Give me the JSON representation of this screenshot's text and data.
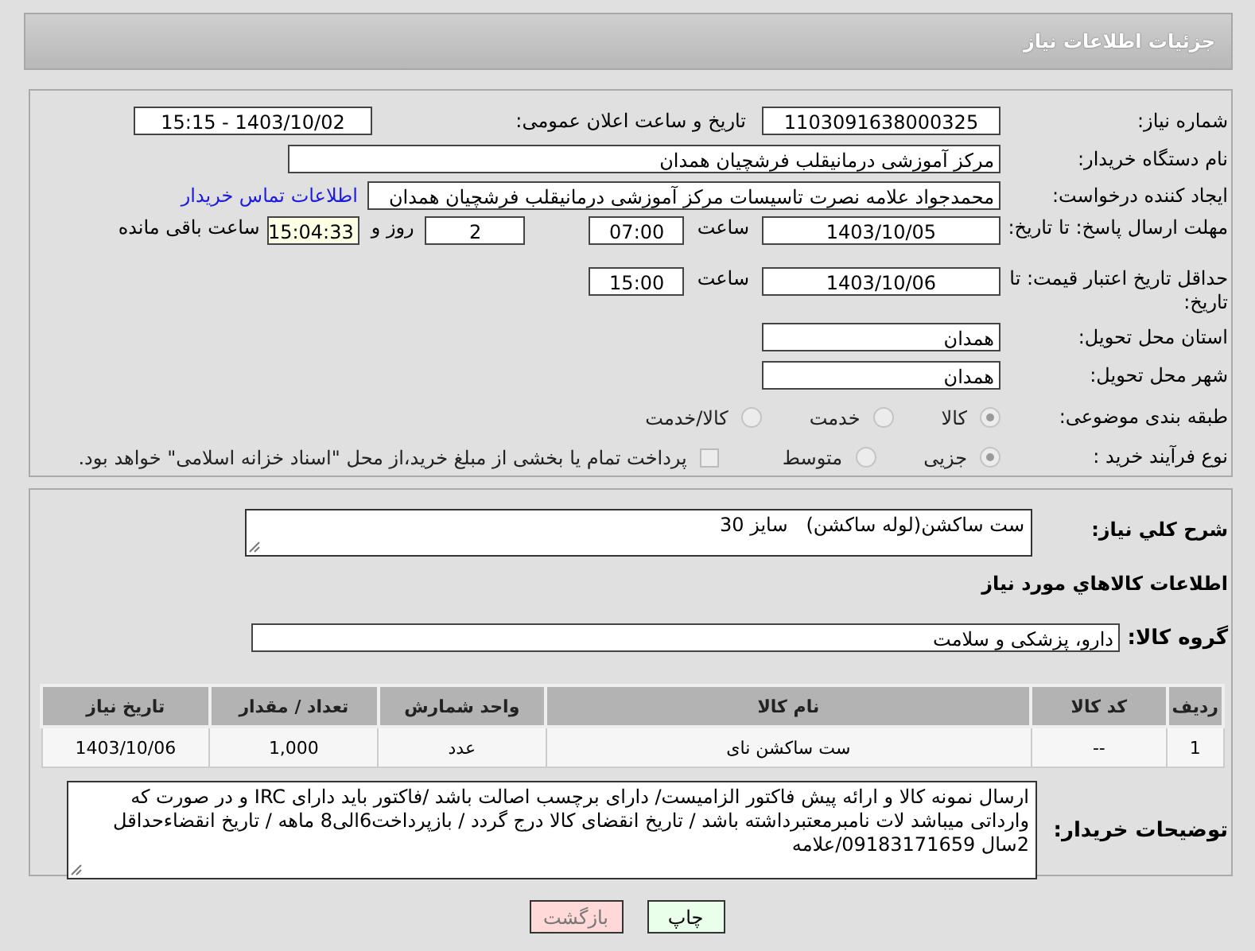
{
  "header": {
    "title": "جزئیات اطلاعات نیاز"
  },
  "need_number": {
    "label": "شماره نیاز:",
    "value": "1103091638000325"
  },
  "announce": {
    "label": "تاریخ و ساعت اعلان عمومی:",
    "value": "1403/10/02 - 15:15"
  },
  "buyer": {
    "label": "نام دستگاه خریدار:",
    "value": "مرکز آموزشی درمانیقلب فرشچیان همدان"
  },
  "creator": {
    "label": "ایجاد کننده درخواست:",
    "value": "محمدجواد علامه نصرت تاسیسات مرکز آموزشی درمانیقلب فرشچیان همدان",
    "link": "اطلاعات تماس خریدار"
  },
  "reply_deadline": {
    "label": "مهلت ارسال پاسخ: تا تاریخ:",
    "date": "1403/10/05",
    "time_label": "ساعت",
    "time": "07:00",
    "days": "2",
    "days_label": "روز و",
    "remaining": "15:04:33",
    "remaining_label": "ساعت باقی مانده"
  },
  "price_validity": {
    "label": "حداقل تاریخ اعتبار قیمت: تا تاریخ:",
    "date": "1403/10/06",
    "time_label": "ساعت",
    "time": "15:00"
  },
  "province": {
    "label": "استان محل تحویل:",
    "value": "همدان"
  },
  "city": {
    "label": "شهر محل تحویل:",
    "value": "همدان"
  },
  "category": {
    "label": "طبقه بندی موضوعی:",
    "options": [
      {
        "label": "کالا",
        "selected": true
      },
      {
        "label": "خدمت",
        "selected": false
      },
      {
        "label": "کالا/خدمت",
        "selected": false
      }
    ]
  },
  "process": {
    "label": "نوع فرآیند خرید :",
    "options": [
      {
        "label": "جزیی",
        "selected": true
      },
      {
        "label": "متوسط",
        "selected": false
      }
    ],
    "payment": {
      "label": "پرداخت تمام یا بخشی از مبلغ خرید،از محل \"اسناد خزانه اسلامی\" خواهد بود.",
      "checked": false
    }
  },
  "description": {
    "label": "شرح کلي نياز:",
    "value": "ست ساکشن(لوله ساکشن)   سایز 30"
  },
  "goods_title": "اطلاعات كالاهاي مورد نياز",
  "goods_group": {
    "label": "گروه کالا:",
    "value": "دارو، پزشکی و سلامت"
  },
  "table": {
    "columns": [
      "ردیف",
      "کد کالا",
      "نام کالا",
      "واحد شمارش",
      "تعداد / مقدار",
      "تاریخ نیاز"
    ],
    "rows": [
      [
        "1",
        "--",
        "ست ساکشن نای",
        "عدد",
        "1,000",
        "1403/10/06"
      ]
    ]
  },
  "buyer_notes": {
    "label": "توضیحات خریدار:",
    "value": "ارسال نمونه کالا و ارائه پیش فاکتور الزامیست/ دارای برچسب اصالت باشد /فاکتور باید دارای IRC و در صورت که وارداتی میباشد لات نامبرمعتبرداشته  باشد / تاریخ انقضای کالا درج گردد / بازپرداخت6الی8 ماهه / تاریخ انقضاءحداقل 2سال 09183171659/علامه"
  },
  "buttons": [
    {
      "label": "چاپ",
      "kind": "print"
    },
    {
      "label": "بازگشت",
      "kind": "back"
    }
  ]
}
